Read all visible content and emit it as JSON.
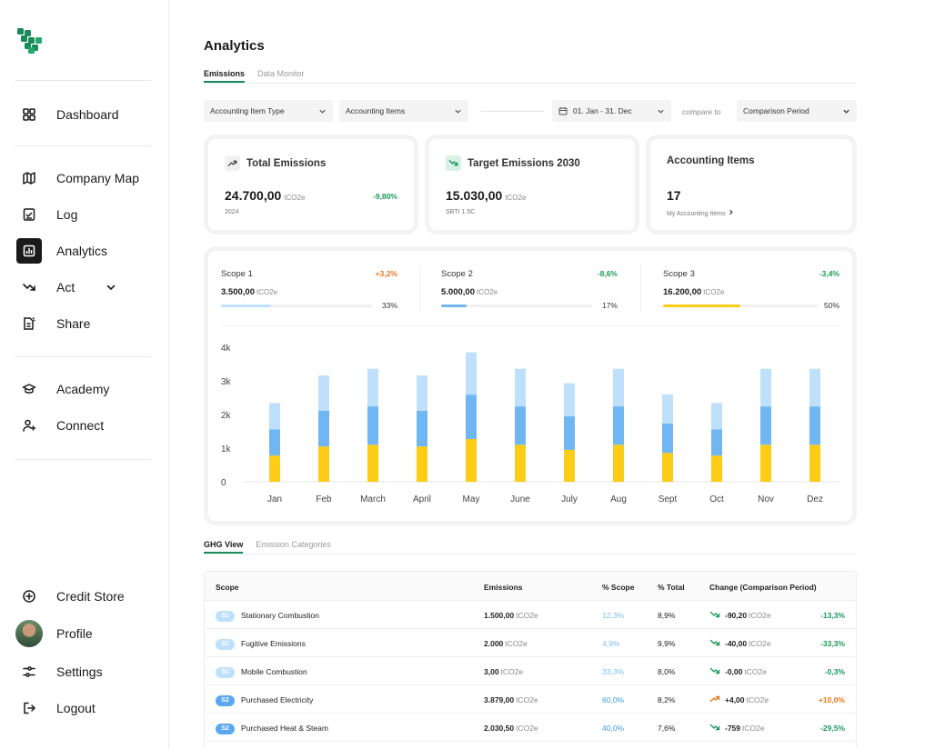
{
  "colors": {
    "brand": "#1a8a5a",
    "scope1": "#bfe0fb",
    "scope2": "#6fb6f3",
    "scope3": "#fdcc16",
    "positive": "#1a9a5a",
    "negative": "#e8781a"
  },
  "sidebar": {
    "logo_icon": "brand-grid-logo",
    "items": [
      {
        "label": "Dashboard",
        "icon": "grid-icon"
      },
      {
        "label": "Company Map",
        "icon": "map-icon"
      },
      {
        "label": "Log",
        "icon": "checklist-icon"
      },
      {
        "label": "Analytics",
        "icon": "chart-icon",
        "active": true
      },
      {
        "label": "Act",
        "icon": "trend-down-icon"
      },
      {
        "label": "Share",
        "icon": "document-share-icon"
      },
      {
        "label": "Academy",
        "icon": "graduation-cap-icon"
      },
      {
        "label": "Connect",
        "icon": "user-plus-icon"
      }
    ],
    "bottom": [
      {
        "label": "Credit Store",
        "icon": "plus-circle-icon"
      },
      {
        "label": "Profile",
        "icon": "avatar"
      },
      {
        "label": "Settings",
        "icon": "sliders-icon"
      },
      {
        "label": "Logout",
        "icon": "logout-icon"
      }
    ]
  },
  "page": {
    "title": "Analytics",
    "tabs": [
      "Emissions",
      "Data Monitor"
    ]
  },
  "filters": {
    "accounting_item_type": "Accounting Item Type",
    "accounting_items": "Accounting Items",
    "date_range": "01. Jan - 31. Dec",
    "compare_label": "compare to",
    "comparison_period": "Comparison Period"
  },
  "cards": {
    "total": {
      "title": "Total Emissions",
      "value": "24.700,00",
      "unit": "tCO2e",
      "sub": "2024",
      "change": "-9,80%"
    },
    "target": {
      "title": "Target Emissions 2030",
      "value": "15.030,00",
      "unit": "tCO2e",
      "sub": "SBTI 1.5C"
    },
    "items": {
      "title": "Accounting Items",
      "value": "17",
      "link": "My Accounting Items"
    }
  },
  "scopes": [
    {
      "name": "Scope 1",
      "change": "+3,2%",
      "value": "3.500,00",
      "unit": "tCO2e",
      "pct": "33%",
      "fill": 0.33
    },
    {
      "name": "Scope 2",
      "change": "-8,6%",
      "value": "5.000,00",
      "unit": "tCO2e",
      "pct": "17%",
      "fill": 0.17
    },
    {
      "name": "Scope 3",
      "change": "-3,4%",
      "value": "16.200,00",
      "unit": "tCO2e",
      "pct": "50%",
      "fill": 0.5
    }
  ],
  "chart_data": {
    "type": "bar",
    "stacked": true,
    "categories": [
      "Jan",
      "Feb",
      "March",
      "April",
      "May",
      "June",
      "July",
      "Aug",
      "Sept",
      "Oct",
      "Nov",
      "Dez"
    ],
    "yticks": [
      "0",
      "1k",
      "2k",
      "3k",
      "4k"
    ],
    "ylim": [
      0,
      4000
    ],
    "series": [
      {
        "values": [
          780,
          1050,
          1100,
          1050,
          1270,
          1100,
          950,
          1100,
          860,
          780,
          1100,
          1100
        ]
      },
      {
        "values": [
          780,
          1060,
          1140,
          1060,
          1320,
          1140,
          1000,
          1140,
          870,
          780,
          1140,
          1140
        ]
      },
      {
        "values": [
          780,
          1050,
          1120,
          1050,
          1260,
          1120,
          980,
          1120,
          870,
          780,
          1120,
          1120
        ]
      }
    ],
    "grid": false,
    "legend": "none"
  },
  "ghg": {
    "tabs": [
      "GHG View",
      "Emission Categories"
    ],
    "headers": {
      "scope": "Scope",
      "emissions": "Emissions",
      "pct_scope": "% Scope",
      "pct_total": "% Total",
      "change": "Change (Comparison Period)"
    },
    "rows": [
      {
        "badge": "S1",
        "name": "Stationary Combustion",
        "emissions": "1.500,00",
        "unit": "tCO2e",
        "pct_scope": "12,3%",
        "pct_total": "8,9%",
        "change": "-90,20",
        "change_unit": "tCO2e",
        "change_pct": "-13,3%",
        "dir": "down"
      },
      {
        "badge": "S1",
        "name": "Fugitive Emissions",
        "emissions": "2.000",
        "unit": "tCO2e",
        "pct_scope": "4,9%",
        "pct_total": "9,9%",
        "change": "-40,00",
        "change_unit": "tCO2e",
        "change_pct": "-33,3%",
        "dir": "down"
      },
      {
        "badge": "S1",
        "name": "Mobile Combustion",
        "emissions": "3,00",
        "unit": "tCO2e",
        "pct_scope": "33,3%",
        "pct_total": "8,0%",
        "change": "-0,00",
        "change_unit": "tCO2e",
        "change_pct": "-0,3%",
        "dir": "down"
      },
      {
        "badge": "S2",
        "name": "Purchased Electricity",
        "emissions": "3.879,00",
        "unit": "tCO2e",
        "pct_scope": "60,0%",
        "pct_total": "8,2%",
        "change": "+4,00",
        "change_unit": "tCO2e",
        "change_pct": "+10,0%",
        "dir": "up"
      },
      {
        "badge": "S2",
        "name": "Purchased Heat & Steam",
        "emissions": "2.030,50",
        "unit": "tCO2e",
        "pct_scope": "40,0%",
        "pct_total": "7,6%",
        "change": "-759",
        "change_unit": "tCO2e",
        "change_pct": "-29,5%",
        "dir": "down"
      }
    ]
  }
}
